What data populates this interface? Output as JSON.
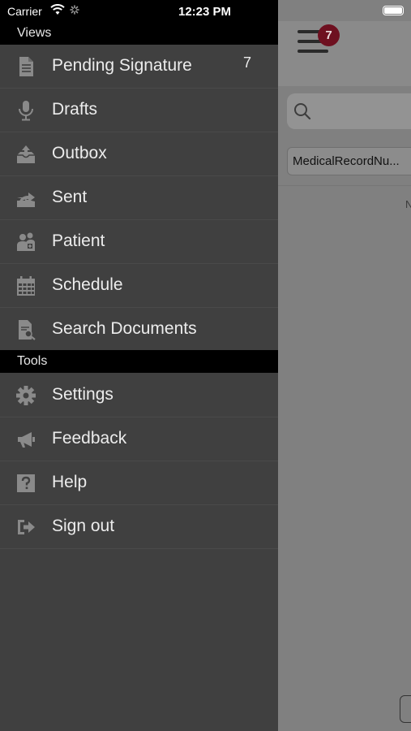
{
  "status_bar": {
    "carrier": "Carrier",
    "time": "12:23 PM"
  },
  "background_app": {
    "menu_badge_count": "7",
    "filter_chip_label": "MedicalRecordNu...",
    "stub_text": "N"
  },
  "drawer": {
    "views_header": "Views",
    "views_items": [
      {
        "label": "Pending Signature",
        "count": "7",
        "icon": "document-icon"
      },
      {
        "label": "Drafts",
        "icon": "microphone-icon"
      },
      {
        "label": "Outbox",
        "icon": "outbox-icon"
      },
      {
        "label": "Sent",
        "icon": "sent-icon"
      },
      {
        "label": "Patient",
        "icon": "patient-icon"
      },
      {
        "label": "Schedule",
        "icon": "calendar-icon"
      },
      {
        "label": "Search Documents",
        "icon": "search-document-icon"
      }
    ],
    "tools_header": "Tools",
    "tools_items": [
      {
        "label": "Settings",
        "icon": "gear-icon"
      },
      {
        "label": "Feedback",
        "icon": "megaphone-icon"
      },
      {
        "label": "Help",
        "icon": "help-icon"
      },
      {
        "label": "Sign out",
        "icon": "sign-out-icon"
      }
    ]
  },
  "colors": {
    "drawer_background": "#404040",
    "section_header_background": "#000000",
    "badge": "#6e1020",
    "icon_gray": "#8a8a8a"
  }
}
